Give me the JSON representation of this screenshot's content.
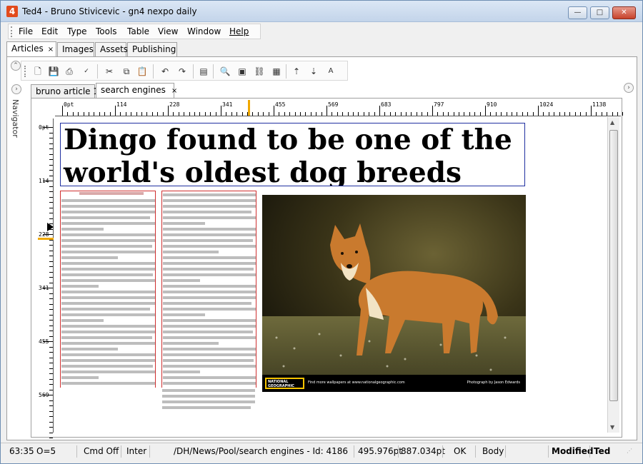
{
  "window": {
    "title": "Ted4 - Bruno Stivicevic - gn4 nexpo daily",
    "app_icon": "4",
    "min": "—",
    "max": "□",
    "close": "✕"
  },
  "menu": [
    "File",
    "Edit",
    "Type",
    "Tools",
    "Table",
    "View",
    "Window",
    "Help"
  ],
  "main_tabs": [
    {
      "label": "Articles",
      "close": "×"
    },
    {
      "label": "Images"
    },
    {
      "label": "Assets"
    },
    {
      "label": "Publishing"
    }
  ],
  "toolbar_icons": [
    "new-icon",
    "save-icon",
    "print-icon",
    "spellcheck-icon",
    "cut-icon",
    "copy-icon",
    "paste-icon",
    "undo-icon",
    "redo-icon",
    "frame-icon",
    "find-icon",
    "insert-icon",
    "link-icon",
    "track-changes-icon",
    "move-up-icon",
    "move-down-icon",
    "font-size-icon"
  ],
  "navigator": {
    "label": "Navigator"
  },
  "doc_tabs": [
    {
      "label": "bruno article 1"
    },
    {
      "label": "search engines",
      "close": "×"
    }
  ],
  "ruler": {
    "h_labels": [
      "0pt",
      "114",
      "228",
      "341",
      "455",
      "569",
      "683",
      "797",
      "910",
      "1024",
      "1138"
    ],
    "v_labels": [
      "0pt",
      "114",
      "228",
      "341",
      "455",
      "569"
    ]
  },
  "article": {
    "headline": "Dingo found to be one of the world's oldest dog breeds"
  },
  "photo": {
    "credit_logo": "NATIONAL GEOGRAPHIC",
    "credit_text": "Find more wallpapers at www.nationalgeographic.com",
    "photographer": "Photograph by Jason Edwards"
  },
  "status": {
    "position": "63:35",
    "offset": "O=5",
    "cmd": "Cmd Off",
    "mode": "Inter",
    "path": "/DH/News/Pool/search engines - Id: 4186",
    "width": "495.976pt",
    "height": "887.034pt",
    "check": "OK",
    "style": "Body",
    "state": "Modified",
    "user": "Ted"
  },
  "colors": {
    "headline_frame": "#2030a0",
    "column_frame": "#d03030",
    "app_icon": "#e24a1c"
  }
}
